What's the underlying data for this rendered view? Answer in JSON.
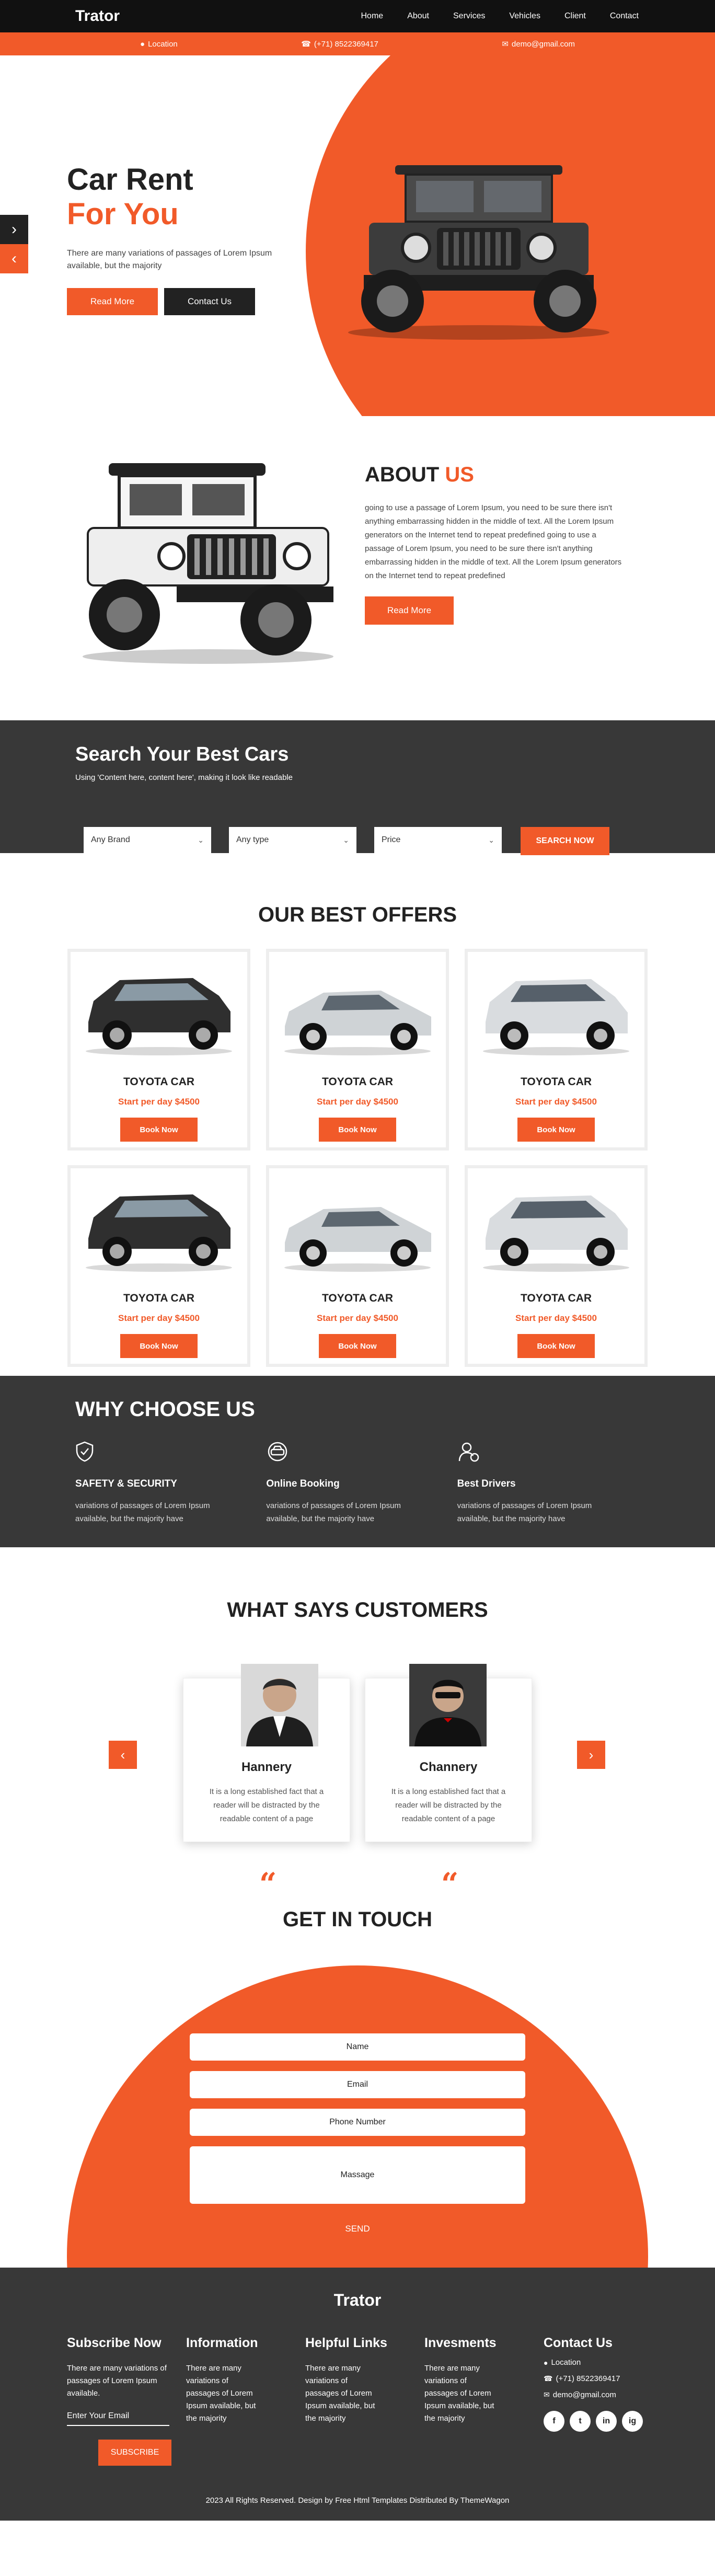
{
  "brand": "Trator",
  "nav": [
    "Home",
    "About",
    "Services",
    "Vehicles",
    "Client",
    "Contact"
  ],
  "infobar": {
    "location": "Location",
    "phone": "(+71) 8522369417",
    "email": "demo@gmail.com"
  },
  "hero": {
    "title_line1": "Car Rent",
    "title_line2": "For You",
    "text": "There are many variations of passages of Lorem Ipsum available, but the majority",
    "read_more": "Read More",
    "contact_us": "Contact Us"
  },
  "about": {
    "title_a": "ABOUT",
    "title_b": "US",
    "text": "going to use a passage of Lorem Ipsum, you need to be sure there isn't anything embarrassing hidden in the middle of text. All the Lorem Ipsum generators on the Internet tend to repeat predefined going to use a passage of Lorem Ipsum, you need to be sure there isn't anything embarrassing hidden in the middle of text. All the Lorem Ipsum generators on the Internet tend to repeat predefined",
    "read_more": "Read More"
  },
  "search": {
    "title": "Search Your Best Cars",
    "subtitle": "Using 'Content here, content here', making it look like readable",
    "brand_select": "Any Brand",
    "type_select": "Any type",
    "price_select": "Price",
    "button": "SEARCH NOW"
  },
  "offers": {
    "title": "OUR BEST OFFERS",
    "cards": [
      {
        "name": "TOYOTA CAR",
        "price": "Start per day $4500",
        "button": "Book Now",
        "car": "dark-suv"
      },
      {
        "name": "TOYOTA CAR",
        "price": "Start per day $4500",
        "button": "Book Now",
        "car": "silver-sedan"
      },
      {
        "name": "TOYOTA CAR",
        "price": "Start per day $4500",
        "button": "Book Now",
        "car": "silver-suv"
      },
      {
        "name": "TOYOTA CAR",
        "price": "Start per day $4500",
        "button": "Book Now",
        "car": "dark-suv"
      },
      {
        "name": "TOYOTA CAR",
        "price": "Start per day $4500",
        "button": "Book Now",
        "car": "silver-sedan"
      },
      {
        "name": "TOYOTA CAR",
        "price": "Start per day $4500",
        "button": "Book Now",
        "car": "silver-suv"
      }
    ]
  },
  "why": {
    "title": "WHY CHOOSE US",
    "items": [
      {
        "title": "SAFETY & SECURITY",
        "text": "variations of passages of Lorem Ipsum available, but the majority have",
        "icon": "shield-check-icon"
      },
      {
        "title": "Online Booking",
        "text": "variations of passages of Lorem Ipsum available, but the majority have",
        "icon": "car-icon"
      },
      {
        "title": "Best Drivers",
        "text": "variations of passages of Lorem Ipsum available, but the majority have",
        "icon": "driver-icon"
      }
    ]
  },
  "testimonials": {
    "title": "WHAT SAYS CUSTOMERS",
    "items": [
      {
        "name": "Hannery",
        "text": "It is a long established fact that a reader will be distracted by the readable content of a page"
      },
      {
        "name": "Channery",
        "text": "It is a long established fact that a reader will be distracted by the readable content of a page"
      }
    ]
  },
  "contact": {
    "title": "GET IN TOUCH",
    "name": "Name",
    "email": "Email",
    "phone": "Phone Number",
    "message": "Massage",
    "send": "SEND"
  },
  "footer": {
    "brand": "Trator",
    "subscribe_title": "Subscribe Now",
    "subscribe_text": "There are many variations of passages of Lorem Ipsum available.",
    "email_placeholder": "Enter Your Email",
    "subscribe_button": "SUBSCRIBE",
    "information_title": "Information",
    "information_text": "There are many variations of passages of Lorem Ipsum available, but the majority",
    "links_title": "Helpful Links",
    "links_text": "There are many variations of passages of Lorem Ipsum available, but the majority",
    "invest_title": "Invesments",
    "invest_text": "There are many variations of passages of Lorem Ipsum available, but the majority",
    "contact_title": "Contact Us",
    "location": "Location",
    "phone": "(+71) 8522369417",
    "email": "demo@gmail.com",
    "socials": [
      "f",
      "t",
      "in",
      "ig"
    ],
    "copyright": "2023 All Rights Reserved. Design by Free Html Templates Distributed By ThemeWagon"
  },
  "colors": {
    "accent": "#f15a29",
    "dark": "#383838",
    "black": "#111111"
  }
}
